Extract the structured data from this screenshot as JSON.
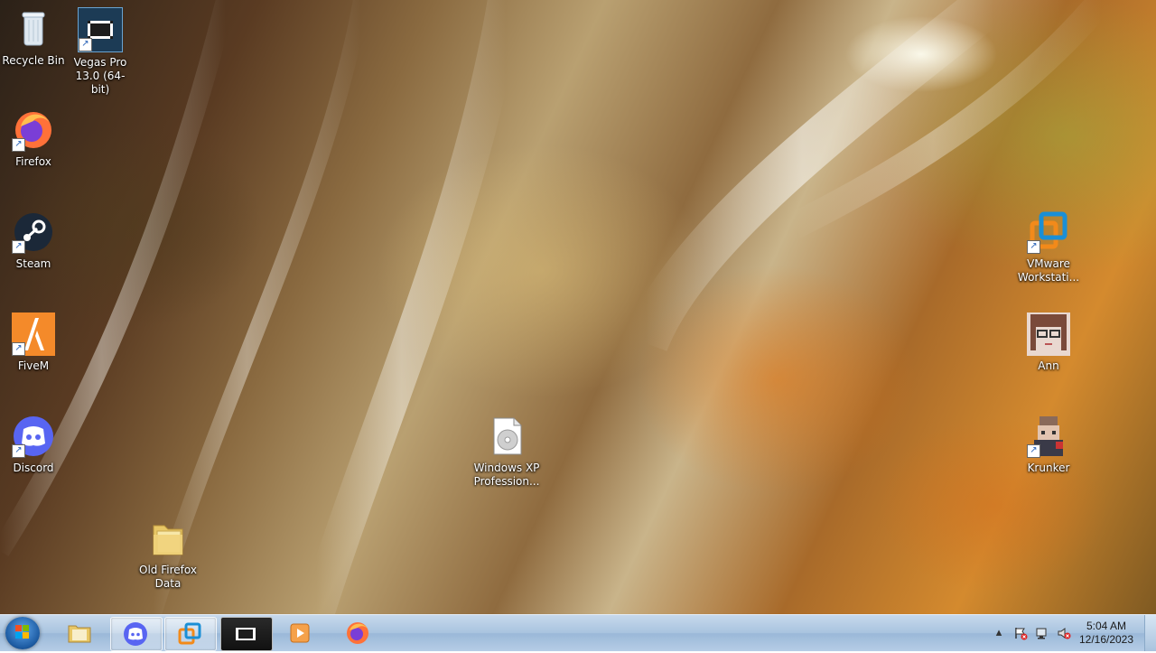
{
  "desktop": {
    "icons": [
      {
        "label": "Recycle Bin",
        "icon": "recycle-bin-icon"
      },
      {
        "label": "Vegas Pro 13.0 (64-bit)",
        "icon": "vegas-pro-icon"
      },
      {
        "label": "Firefox",
        "icon": "firefox-icon"
      },
      {
        "label": "Steam",
        "icon": "steam-icon"
      },
      {
        "label": "FiveM",
        "icon": "fivem-icon"
      },
      {
        "label": "Discord",
        "icon": "discord-icon"
      },
      {
        "label": "Old Firefox Data",
        "icon": "folder-icon"
      },
      {
        "label": "Windows XP Profession...",
        "icon": "disc-image-icon"
      },
      {
        "label": "VMware Workstati...",
        "icon": "vmware-icon"
      },
      {
        "label": "Ann",
        "icon": "anime-avatar-icon"
      },
      {
        "label": "Krunker",
        "icon": "krunker-icon"
      }
    ]
  },
  "taskbar": {
    "pinned": [
      {
        "name": "windows-explorer",
        "icon": "folder-library-icon"
      },
      {
        "name": "discord",
        "icon": "discord-icon",
        "active": true
      },
      {
        "name": "vmware",
        "icon": "vmware-icon",
        "active": true
      },
      {
        "name": "vegas-pro",
        "icon": "vegas-pro-icon",
        "active": true
      },
      {
        "name": "media-player",
        "icon": "media-player-icon"
      },
      {
        "name": "firefox",
        "icon": "firefox-icon"
      }
    ],
    "tray": {
      "time": "5:04 AM",
      "date": "12/16/2023",
      "icons": [
        "show-hidden-icons-icon",
        "action-center-flag-icon",
        "network-icon",
        "volume-muted-icon"
      ]
    }
  },
  "colors": {
    "taskbar": "#a8c3df",
    "discord": "#5865f2",
    "steam": "#1b2838",
    "vmware": "#1a8fd6",
    "firefox": "#ff7139"
  }
}
